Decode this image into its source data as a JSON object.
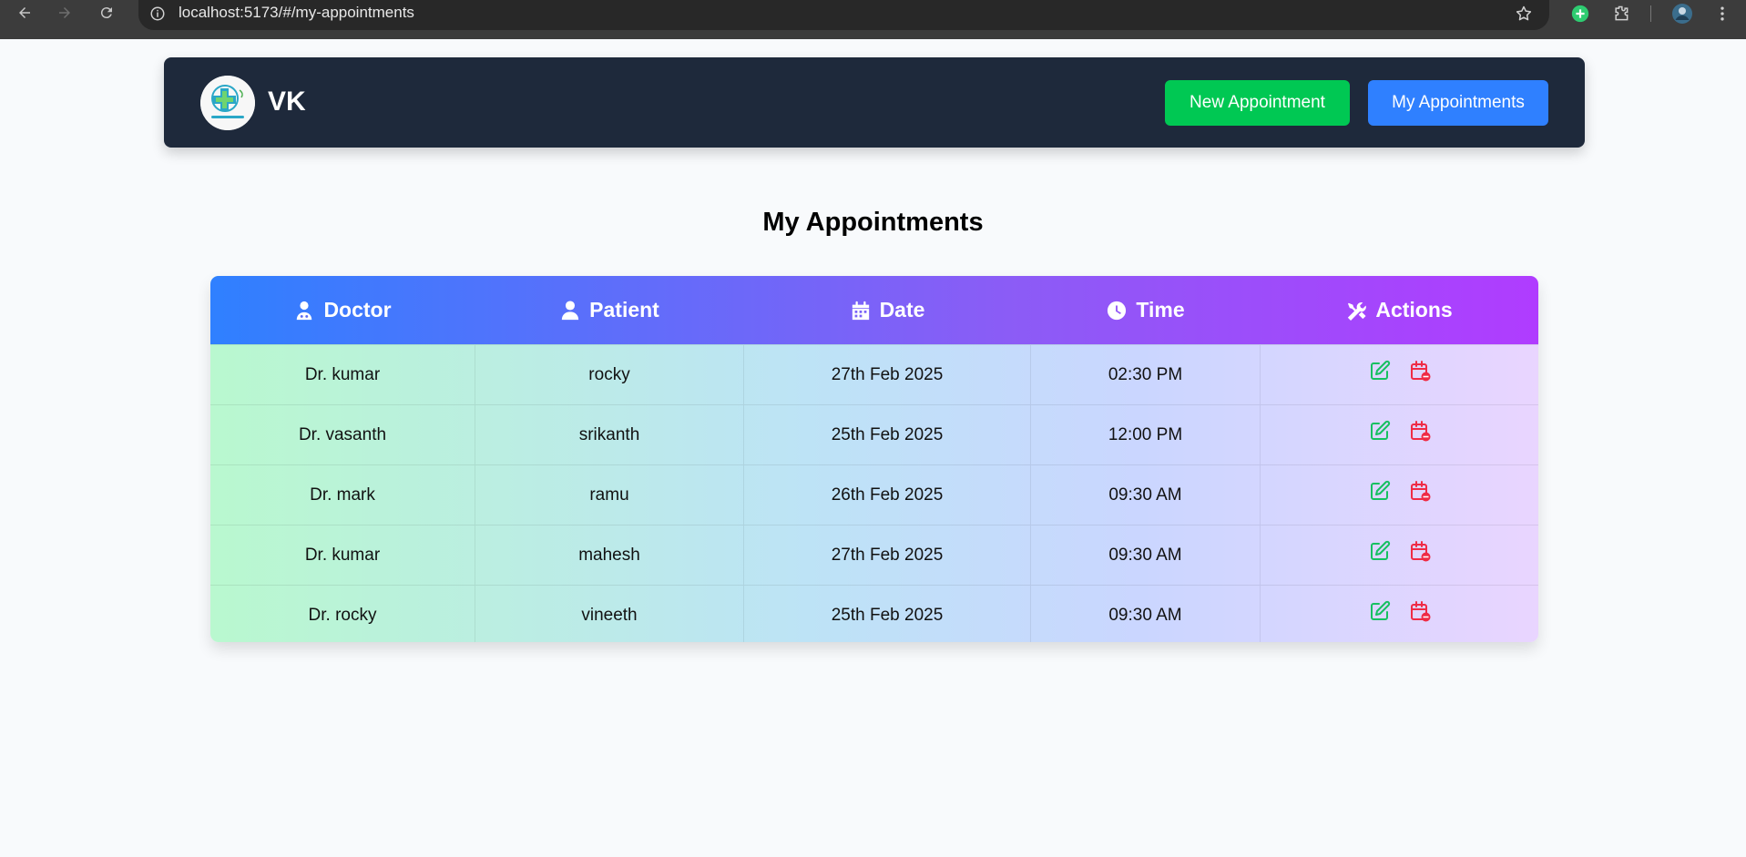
{
  "browser": {
    "url": "localhost:5173/#/my-appointments"
  },
  "header": {
    "brand": "VK",
    "new_appointment_label": "New Appointment",
    "my_appointments_label": "My Appointments"
  },
  "page": {
    "title": "My Appointments"
  },
  "table": {
    "columns": [
      "Doctor",
      "Patient",
      "Date",
      "Time",
      "Actions"
    ],
    "rows": [
      {
        "doctor": "Dr. kumar",
        "patient": "rocky",
        "date": "27th Feb 2025",
        "time": "02:30 PM"
      },
      {
        "doctor": "Dr. vasanth",
        "patient": "srikanth",
        "date": "25th Feb 2025",
        "time": "12:00 PM"
      },
      {
        "doctor": "Dr. mark",
        "patient": "ramu",
        "date": "26th Feb 2025",
        "time": "09:30 AM"
      },
      {
        "doctor": "Dr. kumar",
        "patient": "mahesh",
        "date": "27th Feb 2025",
        "time": "09:30 AM"
      },
      {
        "doctor": "Dr. rocky",
        "patient": "vineeth",
        "date": "25th Feb 2025",
        "time": "09:30 AM"
      }
    ]
  },
  "colors": {
    "header_bg": "#1e293b",
    "new_button": "#00c853",
    "my_button": "#2f80ff",
    "edit_icon": "#16c060",
    "cancel_icon": "#ef2b45"
  }
}
